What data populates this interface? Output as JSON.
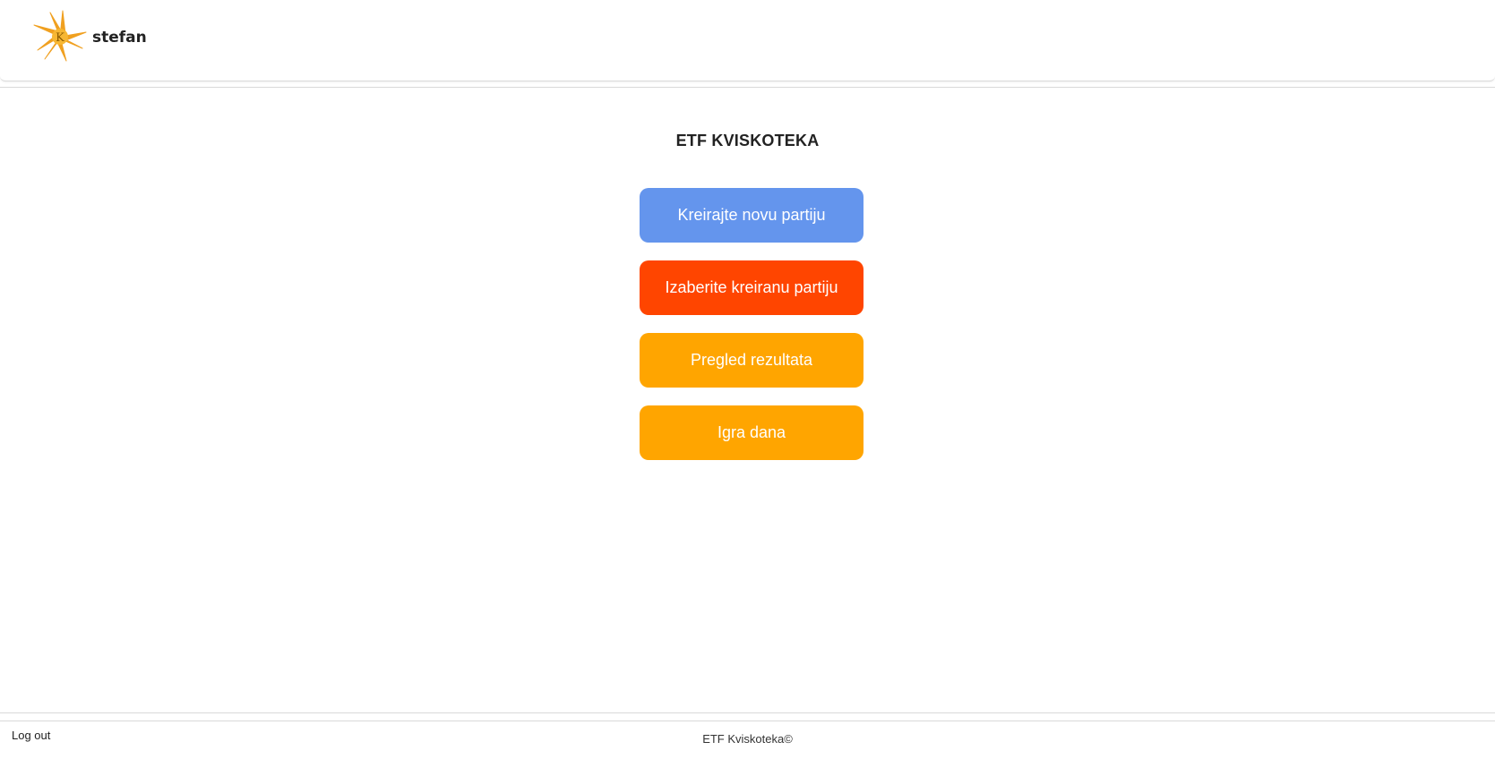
{
  "header": {
    "username": "stefan",
    "logo_icon": "star-burst-k-logo-icon",
    "logo_color": "#f0a020"
  },
  "main": {
    "title": "ETF KVISKOTEKA",
    "buttons": [
      {
        "label": "Kreirajte novu partiju",
        "color": "#6495ed"
      },
      {
        "label": "Izaberite kreiranu partiju",
        "color": "#ff4500"
      },
      {
        "label": "Pregled rezultata",
        "color": "#ffa500"
      },
      {
        "label": "Igra dana",
        "color": "#ffa500"
      }
    ]
  },
  "footer": {
    "logout_label": "Log out",
    "copyright": "ETF Kviskoteka©"
  }
}
